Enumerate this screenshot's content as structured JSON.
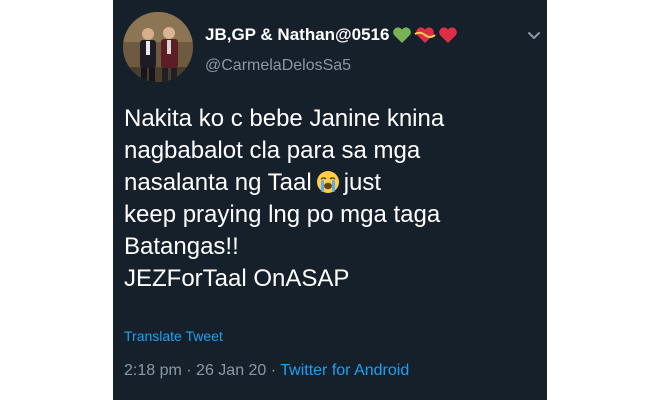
{
  "tweet": {
    "display_name": "JB,GP & Nathan@0516",
    "name_emojis": [
      "green-heart",
      "heart-with-ribbon",
      "red-heart"
    ],
    "handle": "@CarmelaDelosSa5",
    "body_lines": [
      "Nakita ko c bebe Janine knina",
      "nagbabalot cla para sa mga",
      "nasalanta ng Taal",
      "just",
      "keep praying lng po mga taga",
      "Batangas!!",
      "JEZForTaal OnASAP"
    ],
    "inline_emoji": "loudly-crying-face",
    "translate_label": "Translate Tweet",
    "time": "2:18 pm",
    "date": "26 Jan 20",
    "separator": "·",
    "source": "Twitter for Android"
  },
  "colors": {
    "background": "#15202b",
    "text": "#ffffff",
    "secondary": "#8899a6",
    "link": "#1da1f2"
  }
}
